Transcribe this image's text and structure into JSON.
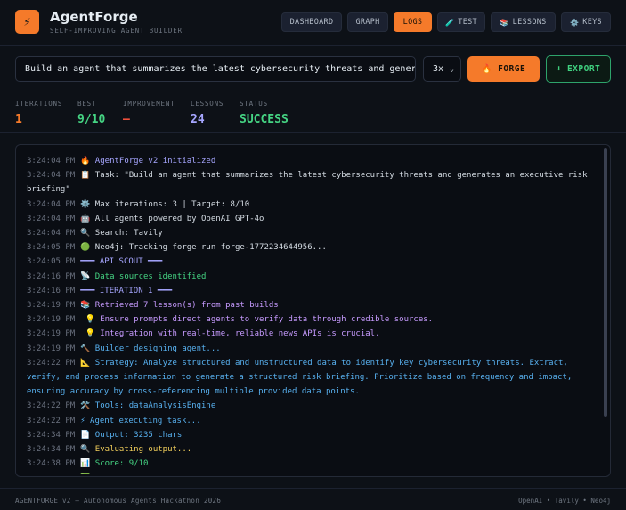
{
  "app": {
    "title": "AgentForge",
    "subtitle": "SELF-IMPROVING AGENT BUILDER",
    "logo_glyph": "⚡"
  },
  "nav": {
    "tabs": [
      {
        "label": "DASHBOARD",
        "icon": "",
        "active": false
      },
      {
        "label": "GRAPH",
        "icon": "",
        "active": false
      },
      {
        "label": "LOGS",
        "icon": "",
        "active": true
      },
      {
        "label": "TEST",
        "icon": "🧪",
        "active": false
      },
      {
        "label": "LESSONS",
        "icon": "📚",
        "active": false
      },
      {
        "label": "KEYS",
        "icon": "⚙️",
        "active": false
      }
    ]
  },
  "prompt": {
    "value": "Build an agent that summarizes the latest cybersecurity threats and generates an executive risk briefing",
    "iterations_selected": "3x",
    "forge_label": "FORGE",
    "forge_icon": "🔥",
    "export_label": "EXPORT",
    "export_icon": "⬇"
  },
  "stats": [
    {
      "label": "ITERATIONS",
      "value": "1",
      "color": "#f57a2a"
    },
    {
      "label": "BEST",
      "value": "9/10",
      "color": "#45d483"
    },
    {
      "label": "IMPROVEMENT",
      "value": "—",
      "color": "#f0503c"
    },
    {
      "label": "LESSONS",
      "value": "24",
      "color": "#a6a6ff"
    },
    {
      "label": "STATUS",
      "value": "SUCCESS",
      "color": "#45d483"
    }
  ],
  "logs": [
    {
      "time": "3:24:04 PM",
      "text": "🔥 AgentForge v2 initialized",
      "tone": "purple"
    },
    {
      "time": "3:24:04 PM",
      "text": "📋 Task: \"Build an agent that summarizes the latest cybersecurity threats and generates an executive risk briefing\"",
      "tone": "white"
    },
    {
      "time": "3:24:04 PM",
      "text": "⚙️ Max iterations: 3 | Target: 8/10",
      "tone": "white"
    },
    {
      "time": "3:24:04 PM",
      "text": "🤖 All agents powered by OpenAI GPT-4o",
      "tone": "white"
    },
    {
      "time": "3:24:04 PM",
      "text": "🔍 Search: Tavily",
      "tone": "white"
    },
    {
      "time": "3:24:05 PM",
      "text": "🟢 Neo4j: Tracking forge run forge-1772234644956...",
      "tone": "white"
    },
    {
      "time": "3:24:05 PM",
      "text": "━━━ API SCOUT ━━━",
      "tone": "purple"
    },
    {
      "time": "3:24:16 PM",
      "text": "📡 Data sources identified",
      "tone": "green"
    },
    {
      "time": "3:24:16 PM",
      "text": "━━━ ITERATION 1 ━━━",
      "tone": "purple"
    },
    {
      "time": "3:24:19 PM",
      "text": "📚 Retrieved 7 lesson(s) from past builds",
      "tone": "pink"
    },
    {
      "time": "3:24:19 PM",
      "text": " 💡 Ensure prompts direct agents to verify data through credible sources.",
      "tone": "pink"
    },
    {
      "time": "3:24:19 PM",
      "text": " 💡 Integration with real-time, reliable news APIs is crucial.",
      "tone": "pink"
    },
    {
      "time": "3:24:19 PM",
      "text": "🔨 Builder designing agent...",
      "tone": "blue"
    },
    {
      "time": "3:24:22 PM",
      "text": "📐 Strategy: Analyze structured and unstructured data to identify key cybersecurity threats. Extract, verify, and process information to generate a structured risk briefing. Prioritize based on frequency and impact, ensuring accuracy by cross-referencing multiple provided data points.",
      "tone": "blue"
    },
    {
      "time": "3:24:22 PM",
      "text": "🛠️ Tools: dataAnalysisEngine",
      "tone": "blue"
    },
    {
      "time": "3:24:22 PM",
      "text": "⚡ Agent executing task...",
      "tone": "blue"
    },
    {
      "time": "3:24:34 PM",
      "text": "📄 Output: 3235 chars",
      "tone": "blue"
    },
    {
      "time": "3:24:34 PM",
      "text": "🔍 Evaluating output...",
      "tone": "yellow"
    },
    {
      "time": "3:24:38 PM",
      "text": "📊 Score: 9/10",
      "tone": "green"
    },
    {
      "time": "3:24:38 PM",
      "text": "✅ Recommendation: Include real-time verification with timestamps for each source and cite primary advisories directly",
      "tone": "green"
    }
  ],
  "footer": {
    "left": "AGENTFORGE v2 — Autonomous Agents Hackathon 2026",
    "right": "OpenAI • Tavily • Neo4j"
  }
}
